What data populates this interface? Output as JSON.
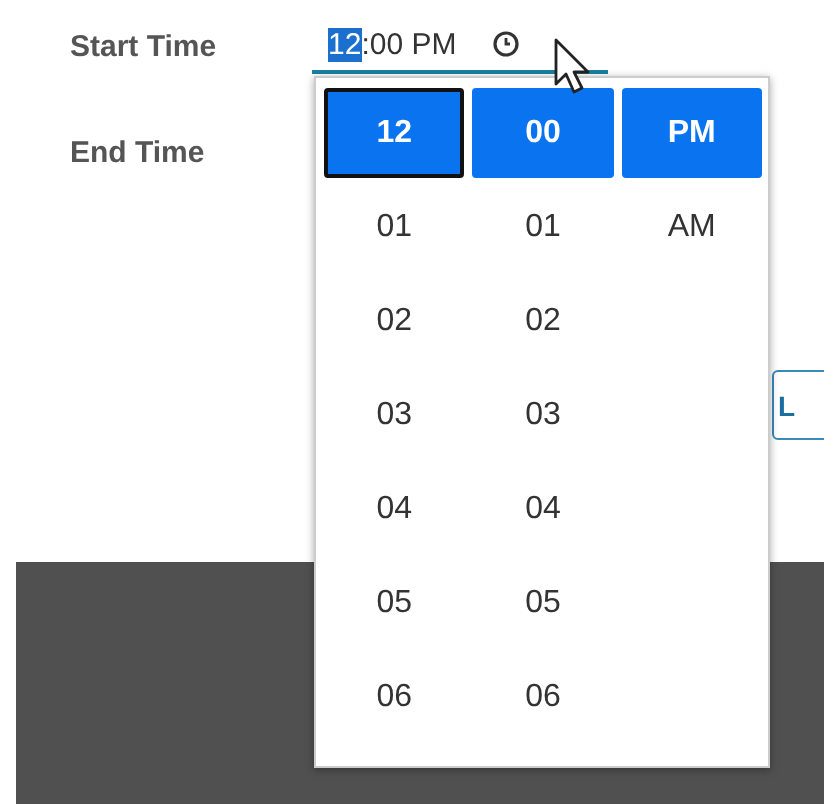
{
  "fields": [
    {
      "label": "Start Time",
      "value_selected": "12",
      "value_rest": ":00 PM",
      "focused": true
    },
    {
      "label": "End Time"
    }
  ],
  "button": {
    "label": "L"
  },
  "time_picker": {
    "columns": [
      {
        "items": [
          {
            "text": "12",
            "selected": true,
            "focused": true
          },
          {
            "text": "01",
            "selected": false,
            "focused": false
          },
          {
            "text": "02",
            "selected": false,
            "focused": false
          },
          {
            "text": "03",
            "selected": false,
            "focused": false
          },
          {
            "text": "04",
            "selected": false,
            "focused": false
          },
          {
            "text": "05",
            "selected": false,
            "focused": false
          },
          {
            "text": "06",
            "selected": false,
            "focused": false
          }
        ]
      },
      {
        "items": [
          {
            "text": "00",
            "selected": true,
            "focused": false
          },
          {
            "text": "01",
            "selected": false,
            "focused": false
          },
          {
            "text": "02",
            "selected": false,
            "focused": false
          },
          {
            "text": "03",
            "selected": false,
            "focused": false
          },
          {
            "text": "04",
            "selected": false,
            "focused": false
          },
          {
            "text": "05",
            "selected": false,
            "focused": false
          },
          {
            "text": "06",
            "selected": false,
            "focused": false
          }
        ]
      },
      {
        "items": [
          {
            "text": "PM",
            "selected": true,
            "focused": false
          },
          {
            "text": "AM",
            "selected": false,
            "focused": false
          }
        ]
      }
    ]
  }
}
